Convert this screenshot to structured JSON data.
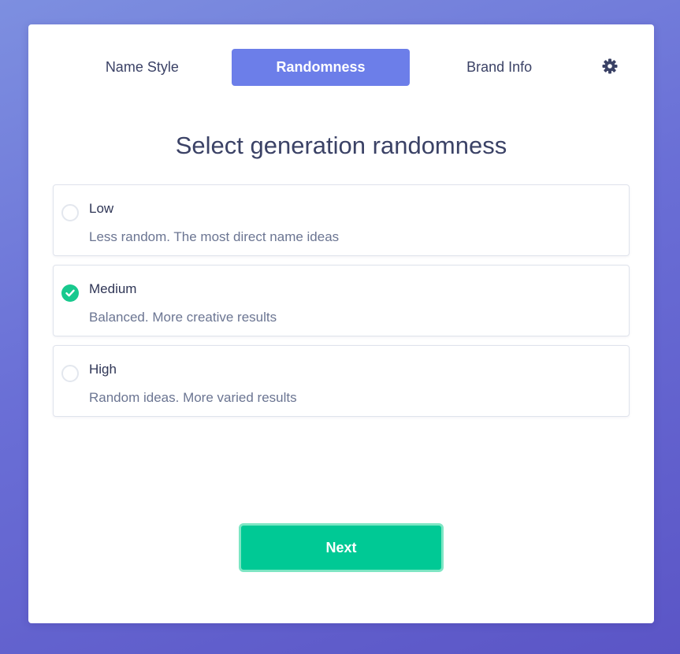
{
  "tabs": [
    {
      "label": "Name Style",
      "active": false
    },
    {
      "label": "Randomness",
      "active": true
    },
    {
      "label": "Brand Info",
      "active": false
    }
  ],
  "settings_icon": "gear-icon",
  "title": "Select generation randomness",
  "options": [
    {
      "label": "Low",
      "description": "Less random. The most direct name ideas",
      "selected": false
    },
    {
      "label": "Medium",
      "description": "Balanced. More creative results",
      "selected": true
    },
    {
      "label": "High",
      "description": "Random ideas. More varied results",
      "selected": false
    }
  ],
  "next_button": {
    "label": "Next"
  },
  "colors": {
    "accent": "#6c7ee9",
    "success": "#00c995",
    "text": "#3b4266",
    "muted": "#6b7592"
  }
}
